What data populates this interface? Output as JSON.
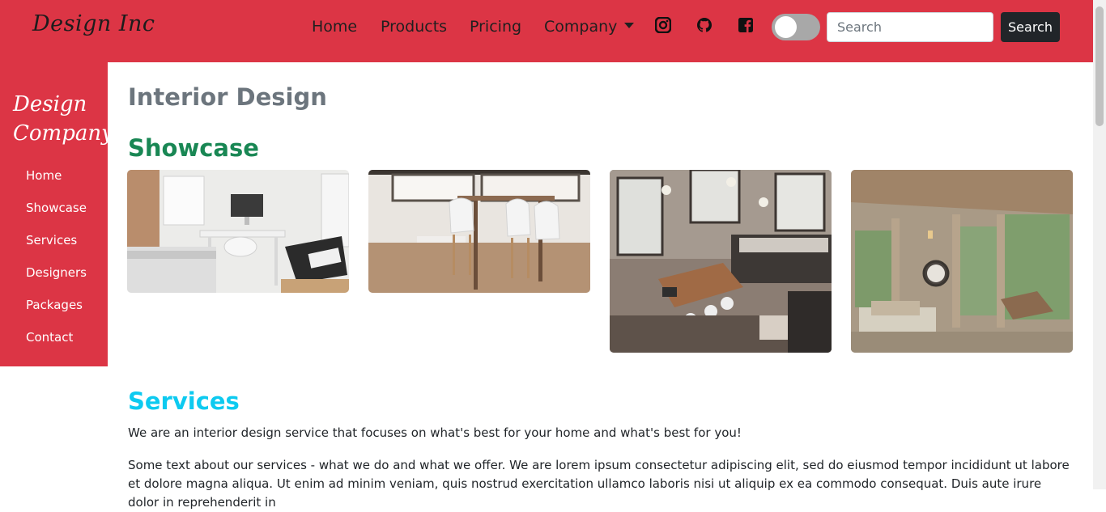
{
  "navbar": {
    "brand": "Design Inc",
    "links": [
      {
        "label": "Home"
      },
      {
        "label": "Products"
      },
      {
        "label": "Pricing"
      },
      {
        "label": "Company"
      }
    ],
    "social_icons": [
      "instagram-icon",
      "github-icon",
      "facebook-icon"
    ],
    "toggle_on": false,
    "search": {
      "placeholder": "Search",
      "value": "",
      "button_label": "Search"
    }
  },
  "sidebar": {
    "brand_line1": "Design",
    "brand_line2": "Company",
    "items": [
      {
        "label": "Home"
      },
      {
        "label": "Showcase"
      },
      {
        "label": "Services"
      },
      {
        "label": "Designers"
      },
      {
        "label": "Packages"
      },
      {
        "label": "Contact"
      }
    ]
  },
  "main": {
    "title": "Interior Design",
    "showcase": {
      "heading": "Showcase",
      "photos": [
        "bedroom-photo",
        "dining-room-photo",
        "loft-kitchen-photo",
        "sunroom-photo"
      ]
    },
    "services": {
      "heading": "Services",
      "intro": "We are an interior design service that focuses on what's best for your home and what's best for you!",
      "body": "Some text about our services - what we do and what we offer. We are lorem ipsum consectetur adipiscing elit, sed do eiusmod tempor incididunt ut labore et dolore magna aliqua. Ut enim ad minim veniam, quis nostrud exercitation ullamco laboris nisi ut aliquip ex ea commodo consequat. Duis aute irure dolor in reprehenderit in"
    }
  },
  "colors": {
    "brand_red": "#dc3545",
    "showcase_green": "#198754",
    "services_cyan": "#0dcaf0",
    "muted_gray": "#6c757d",
    "dark_button": "#212529"
  }
}
